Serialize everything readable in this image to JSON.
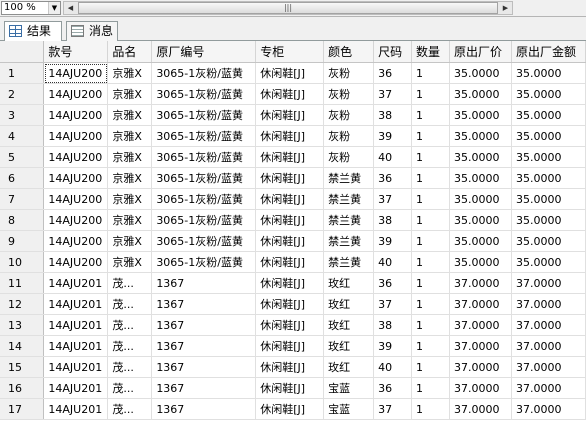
{
  "toolbar": {
    "zoom": "100 %",
    "zoom_arrow": "▼",
    "scroll_left": "◀",
    "scroll_right": "▶",
    "thumb_grip": "|||"
  },
  "tabs": [
    {
      "label": "结果",
      "active": true
    },
    {
      "label": "消息",
      "active": false
    }
  ],
  "columns": [
    "款号",
    "品名",
    "原厂编号",
    "专柜",
    "颜色",
    "尺码",
    "数量",
    "原出厂价",
    "原出厂金额"
  ],
  "rows": [
    {
      "n": "1",
      "c": [
        "14AJU200",
        "京雅X",
        "3065-1灰粉/蓝黄",
        "休闲鞋[J]",
        "灰粉",
        "36",
        "1",
        "35.0000",
        "35.0000"
      ]
    },
    {
      "n": "2",
      "c": [
        "14AJU200",
        "京雅X",
        "3065-1灰粉/蓝黄",
        "休闲鞋[J]",
        "灰粉",
        "37",
        "1",
        "35.0000",
        "35.0000"
      ]
    },
    {
      "n": "3",
      "c": [
        "14AJU200",
        "京雅X",
        "3065-1灰粉/蓝黄",
        "休闲鞋[J]",
        "灰粉",
        "38",
        "1",
        "35.0000",
        "35.0000"
      ]
    },
    {
      "n": "4",
      "c": [
        "14AJU200",
        "京雅X",
        "3065-1灰粉/蓝黄",
        "休闲鞋[J]",
        "灰粉",
        "39",
        "1",
        "35.0000",
        "35.0000"
      ]
    },
    {
      "n": "5",
      "c": [
        "14AJU200",
        "京雅X",
        "3065-1灰粉/蓝黄",
        "休闲鞋[J]",
        "灰粉",
        "40",
        "1",
        "35.0000",
        "35.0000"
      ]
    },
    {
      "n": "6",
      "c": [
        "14AJU200",
        "京雅X",
        "3065-1灰粉/蓝黄",
        "休闲鞋[J]",
        "禁兰黄",
        "36",
        "1",
        "35.0000",
        "35.0000"
      ]
    },
    {
      "n": "7",
      "c": [
        "14AJU200",
        "京雅X",
        "3065-1灰粉/蓝黄",
        "休闲鞋[J]",
        "禁兰黄",
        "37",
        "1",
        "35.0000",
        "35.0000"
      ]
    },
    {
      "n": "8",
      "c": [
        "14AJU200",
        "京雅X",
        "3065-1灰粉/蓝黄",
        "休闲鞋[J]",
        "禁兰黄",
        "38",
        "1",
        "35.0000",
        "35.0000"
      ]
    },
    {
      "n": "9",
      "c": [
        "14AJU200",
        "京雅X",
        "3065-1灰粉/蓝黄",
        "休闲鞋[J]",
        "禁兰黄",
        "39",
        "1",
        "35.0000",
        "35.0000"
      ]
    },
    {
      "n": "10",
      "c": [
        "14AJU200",
        "京雅X",
        "3065-1灰粉/蓝黄",
        "休闲鞋[J]",
        "禁兰黄",
        "40",
        "1",
        "35.0000",
        "35.0000"
      ]
    },
    {
      "n": "11",
      "c": [
        "14AJU201",
        "茂...",
        "1367",
        "休闲鞋[J]",
        "玫红",
        "36",
        "1",
        "37.0000",
        "37.0000"
      ]
    },
    {
      "n": "12",
      "c": [
        "14AJU201",
        "茂...",
        "1367",
        "休闲鞋[J]",
        "玫红",
        "37",
        "1",
        "37.0000",
        "37.0000"
      ]
    },
    {
      "n": "13",
      "c": [
        "14AJU201",
        "茂...",
        "1367",
        "休闲鞋[J]",
        "玫红",
        "38",
        "1",
        "37.0000",
        "37.0000"
      ]
    },
    {
      "n": "14",
      "c": [
        "14AJU201",
        "茂...",
        "1367",
        "休闲鞋[J]",
        "玫红",
        "39",
        "1",
        "37.0000",
        "37.0000"
      ]
    },
    {
      "n": "15",
      "c": [
        "14AJU201",
        "茂...",
        "1367",
        "休闲鞋[J]",
        "玫红",
        "40",
        "1",
        "37.0000",
        "37.0000"
      ]
    },
    {
      "n": "16",
      "c": [
        "14AJU201",
        "茂...",
        "1367",
        "休闲鞋[J]",
        "宝蓝",
        "36",
        "1",
        "37.0000",
        "37.0000"
      ]
    },
    {
      "n": "17",
      "c": [
        "14AJU201",
        "茂...",
        "1367",
        "休闲鞋[J]",
        "宝蓝",
        "37",
        "1",
        "37.0000",
        "37.0000"
      ]
    }
  ]
}
